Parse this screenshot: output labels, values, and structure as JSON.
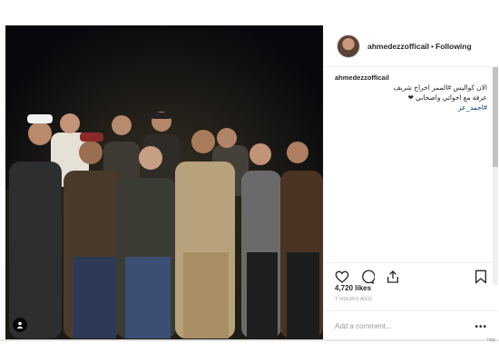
{
  "post": {
    "header": {
      "username": "ahmedezzofficail",
      "separator": "•",
      "follow_label": "Following"
    },
    "caption": {
      "username": "ahmedezzofficail",
      "text_line1": "الان كواليس #الممر اخراج شريف",
      "text_line2": "عرفة مع اخواتي واصحابي ❤",
      "hashtag": "#احمد_عز"
    },
    "likes": "4,720 likes",
    "time": "7 HOURS AGO",
    "comment_placeholder": "Add a comment...",
    "more_label": "•••",
    "corner_text": "http"
  },
  "icons": {
    "like": "heart-icon",
    "comment": "comment-icon",
    "share": "share-icon",
    "save": "bookmark-icon",
    "tagged": "user-tag-icon",
    "more": "more-options-icon"
  },
  "colors": {
    "link": "#003569",
    "text": "#262626",
    "muted": "#999999",
    "border": "#efefef",
    "photo_bg": "#07080c"
  }
}
